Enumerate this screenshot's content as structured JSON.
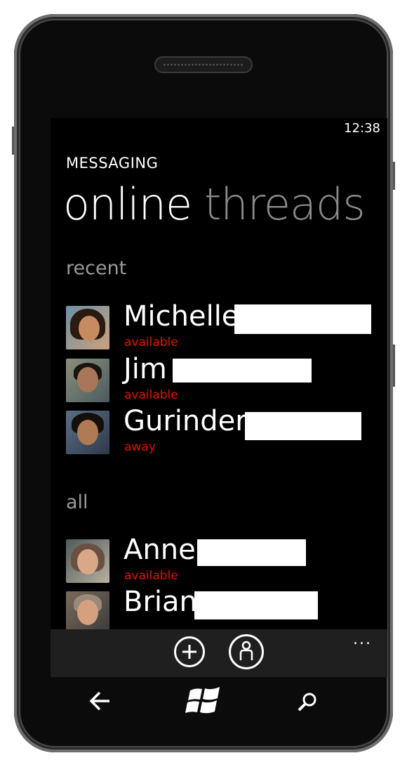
{
  "status_bar": {
    "time": "12:38"
  },
  "app": {
    "title": "MESSAGING"
  },
  "pivot": {
    "active": "online",
    "inactive": "threads"
  },
  "sections": {
    "recent": "recent",
    "all": "all"
  },
  "recent_contacts": [
    {
      "name": "Michelle",
      "status": "available"
    },
    {
      "name": "Jim",
      "status": "available"
    },
    {
      "name": "Gurinder",
      "status": "away"
    }
  ],
  "all_contacts": [
    {
      "name": "Anne",
      "status": "available"
    },
    {
      "name": "Brian",
      "status": ""
    }
  ],
  "app_bar": {
    "buttons": [
      "add-icon",
      "contact-icon"
    ],
    "more": "..."
  },
  "hardware": {
    "buttons": [
      "back-icon",
      "windows-start-icon",
      "search-icon"
    ]
  },
  "colors": {
    "accent": "#e51400",
    "background": "#000000",
    "app_bar": "#1f1f1f"
  }
}
